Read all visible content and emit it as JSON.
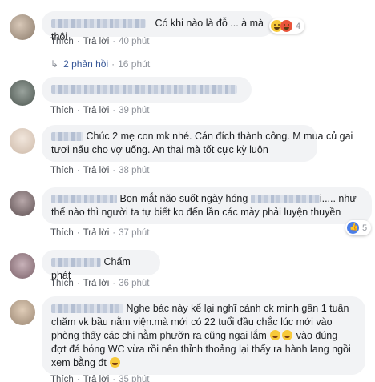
{
  "comments": [
    {
      "text": "Có khi nào là đỗ ... à mà thôi",
      "reaction_count": "4",
      "like": "Thích",
      "reply": "Trả lời",
      "time": "40 phút",
      "avatar_color": "#b7a79a"
    },
    {
      "text": "",
      "like": "Thích",
      "reply": "Trả lời",
      "time": "39 phút",
      "avatar_color": "#6b7770"
    },
    {
      "text_line1": "Chúc 2 mẹ con mk nhé. Cán đích thành công. M mua củ gai",
      "text_line2": "tươi nấu cho vợ uống. An thai mà tốt cực kỳ luôn",
      "like": "Thích",
      "reply": "Trả lời",
      "time": "38 phút",
      "avatar_color": "#e3d5c8"
    },
    {
      "text_part1": "Bọn mắt não suốt ngày hóng",
      "text_part2": "i..... như",
      "text_line2": "thế nào thì người ta tự biết ko đến lần các mày phải luyện thuyền",
      "reaction_count": "5",
      "like": "Thích",
      "reply": "Trả lời",
      "time": "37 phút",
      "avatar_color": "#8a7d80"
    },
    {
      "text": "Chấm phát",
      "like": "Thích",
      "reply": "Trả lời",
      "time": "36 phút",
      "avatar_color": "#a08a92"
    },
    {
      "text_line1": "Nghe bác này kể lại nghĩ cảnh ck mình gần 1 tuần",
      "text_line2": "chăm vk bầu nằm viện.mà mới có 22 tuổi đầu chắc lúc mới vào",
      "text_line3": "phòng thấy các chị nằm phưỡn ra cũng ngại lắm",
      "text_line3b": "vào đúng",
      "text_line4": "đợt đá bóng WC vừa rồi nên thỉnh thoảng lại thấy ra hành lang ngồi",
      "text_line5": "xem bằng đt",
      "like": "Thích",
      "reply": "Trả lời",
      "time": "35 phút",
      "avatar_color": "#c9b39b"
    }
  ],
  "replies": {
    "label": "2 phản hồi",
    "time": "16 phút"
  }
}
